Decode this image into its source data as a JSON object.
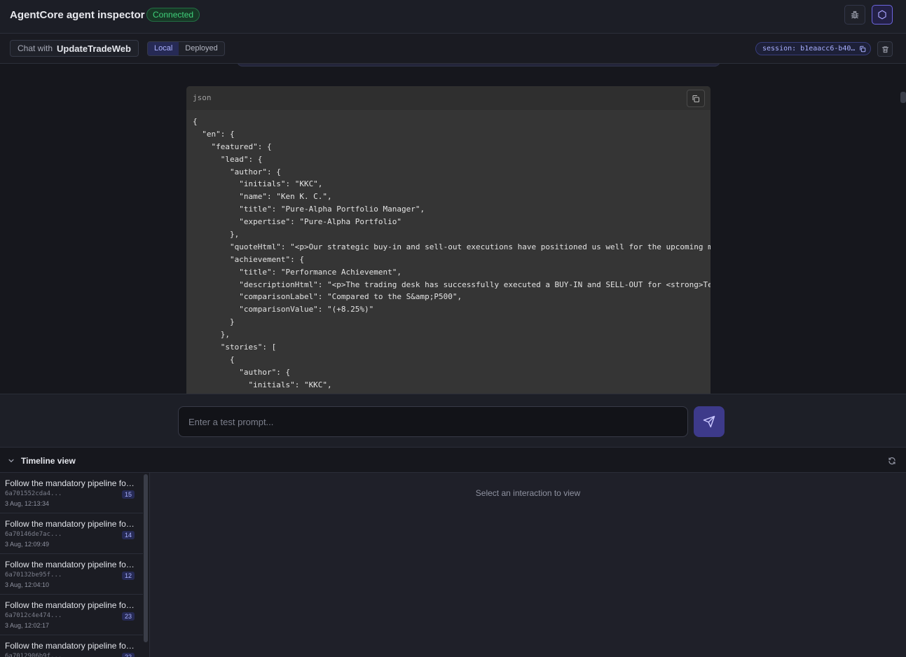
{
  "header": {
    "title": "AgentCore agent inspector",
    "status": "Connected",
    "debug_icon": "bug-icon",
    "active_icon": "hexagon-icon"
  },
  "subbar": {
    "chat_prefix": "Chat with",
    "agent_name": "UpdateTradeWeb",
    "modes": [
      "Local",
      "Deployed"
    ],
    "active_mode": "Local",
    "session_label": "session: b1eaacc6-b40…"
  },
  "code_block": {
    "language": "json",
    "lines": [
      "{",
      "  \"en\": {",
      "    \"featured\": {",
      "      \"lead\": {",
      "        \"author\": {",
      "          \"initials\": \"KKC\",",
      "          \"name\": \"Ken K. C.\",",
      "          \"title\": \"Pure-Alpha Portfolio Manager\",",
      "          \"expertise\": \"Pure-Alpha Portfolio\"",
      "        },",
      "        \"quoteHtml\": \"<p>Our strategic buy-in and sell-out executions have positioned us well for the upcoming ma",
      "        \"achievement\": {",
      "          \"title\": \"Performance Achievement\",",
      "          \"descriptionHtml\": \"<p>The trading desk has successfully executed a BUY-IN and SELL-OUT for <strong>Ten",
      "          \"comparisonLabel\": \"Compared to the S&amp;P500\",",
      "          \"comparisonValue\": \"(+8.25%)\"",
      "        }",
      "      },",
      "      \"stories\": [",
      "        {",
      "          \"author\": {",
      "            \"initials\": \"KKC\","
    ]
  },
  "input": {
    "placeholder": "Enter a test prompt..."
  },
  "timeline": {
    "title": "Timeline view",
    "empty_text": "Select an interaction to view",
    "items": [
      {
        "title": "Follow the mandatory pipeline for the request",
        "id": "6a701552cda4...",
        "time": "3 Aug, 12:13:34",
        "count": "15"
      },
      {
        "title": "Follow the mandatory pipeline for the request",
        "id": "6a70146de7ac...",
        "time": "3 Aug, 12:09:49",
        "count": "14"
      },
      {
        "title": "Follow the mandatory pipeline for the request",
        "id": "6a70132be95f...",
        "time": "3 Aug, 12:04:10",
        "count": "12"
      },
      {
        "title": "Follow the mandatory pipeline for the request",
        "id": "6a7012c4e474...",
        "time": "3 Aug, 12:02:17",
        "count": "23"
      },
      {
        "title": "Follow the mandatory pipeline for the request",
        "id": "6a7012906b9f...",
        "time": "",
        "count": "22"
      }
    ]
  }
}
